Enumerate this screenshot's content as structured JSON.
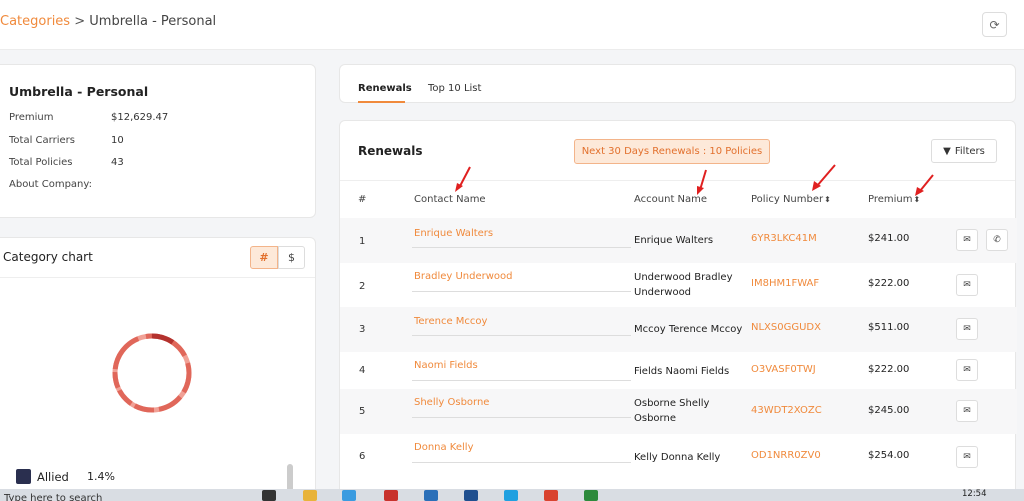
{
  "breadcrumb": {
    "root": "Categories",
    "separator": ">",
    "current": "Umbrella - Personal"
  },
  "info": {
    "title": "Umbrella - Personal",
    "rows": [
      {
        "label": "Premium",
        "value": "$12,629.47"
      },
      {
        "label": "Total Carriers",
        "value": "10"
      },
      {
        "label": "Total Policies",
        "value": "43"
      },
      {
        "label": "About Company:",
        "value": ""
      }
    ]
  },
  "chart": {
    "title": "Category chart",
    "toggle_count": "#",
    "toggle_amount": "$",
    "legend": [
      {
        "name": "Allied",
        "pct": "1.4%",
        "color": "#2a2f4f"
      }
    ]
  },
  "tabs": [
    {
      "label": "Renewals"
    },
    {
      "label": "Top 10 List"
    }
  ],
  "renewals": {
    "title": "Renewals",
    "badge": "Next 30 Days Renewals : 10 Policies",
    "filters_label": "Filters",
    "columns": {
      "num": "#",
      "contact": "Contact Name",
      "account": "Account Name",
      "policy": "Policy Number",
      "premium": "Premium"
    },
    "rows": [
      {
        "num": "1",
        "contact": "Enrique Walters",
        "account": "Enrique Walters",
        "policy": "6YR3LKC41M",
        "premium": "$241.00"
      },
      {
        "num": "2",
        "contact": "Bradley Underwood",
        "account": "Underwood Bradley Underwood",
        "policy": "IM8HM1FWAF",
        "premium": "$222.00"
      },
      {
        "num": "3",
        "contact": "Terence Mccoy",
        "account": "Mccoy Terence Mccoy",
        "policy": "NLXS0GGUDX",
        "premium": "$511.00"
      },
      {
        "num": "4",
        "contact": "Naomi Fields",
        "account": "Fields Naomi Fields",
        "policy": "O3VASF0TWJ",
        "premium": "$222.00"
      },
      {
        "num": "5",
        "contact": "Shelly Osborne",
        "account": "Osborne Shelly Osborne",
        "policy": "43WDT2XOZC",
        "premium": "$245.00"
      },
      {
        "num": "6",
        "contact": "Donna Kelly",
        "account": "Kelly Donna Kelly",
        "policy": "OD1NRR0ZV0",
        "premium": "$254.00"
      }
    ]
  },
  "taskbar": {
    "search": "Type here to search",
    "time": "12:54"
  },
  "colors": {
    "accent": "#f08a3c",
    "annotation_arrow": "#e02020",
    "donut": "#e0675a"
  }
}
